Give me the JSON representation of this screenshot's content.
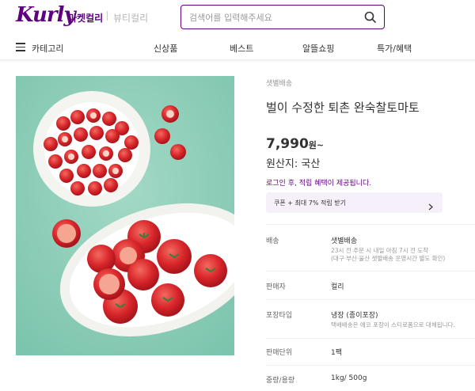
{
  "header": {
    "logo": "Kurly",
    "tabs": [
      "마켓컬리",
      "뷰티컬리"
    ],
    "search_placeholder": "검색어를 입력해주세요"
  },
  "gnb": {
    "category": "카테고리",
    "items": [
      "신상품",
      "베스트",
      "알뜰쇼핑",
      "특가/혜택"
    ]
  },
  "product": {
    "delivery_tag": "샛별배송",
    "name": "벌이 수정한 퇴촌 완숙찰토마토",
    "price": "7,990",
    "price_unit": "원~",
    "origin": "원산지: 국산",
    "login_notice": "로그인 후, 적립 혜택이 제공됩니다.",
    "coupon_label": "쿠폰 + 최대 7% 적립 받기"
  },
  "details": [
    {
      "key": "배송",
      "value": "샛별배송",
      "sub": [
        "23시 전 주문 시 내일 아침 7시 전 도착",
        "(대구·부산·울산 샛별배송 운영시간 별도 확인)"
      ]
    },
    {
      "key": "판매자",
      "value": "컬리",
      "sub": []
    },
    {
      "key": "포장타입",
      "value": "냉장 (종이포장)",
      "sub": [
        "택배배송은 에코 포장이 스티로폼으로 대체됩니다."
      ]
    },
    {
      "key": "판매단위",
      "value": "1팩",
      "sub": []
    },
    {
      "key": "중량/용량",
      "value": "1kg/ 500g",
      "sub": []
    }
  ],
  "colors": {
    "brand": "#5f0080",
    "background_image": "#8ecdb7"
  },
  "icons": {
    "search": "search-icon",
    "menu": "hamburger-icon",
    "coupon_arrow": "chevron-right-icon"
  }
}
